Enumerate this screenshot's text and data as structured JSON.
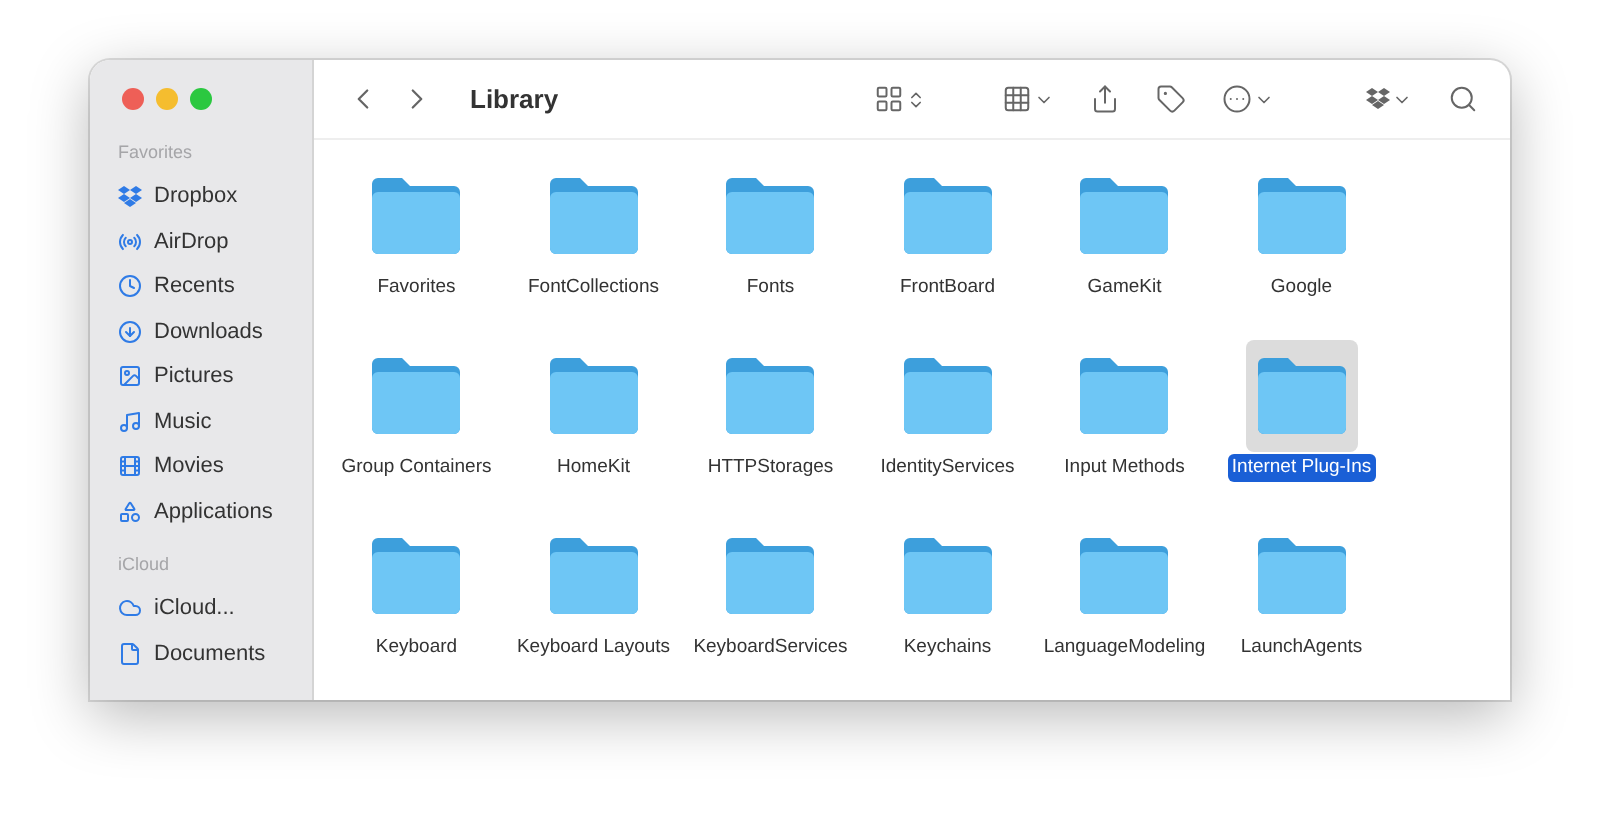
{
  "toolbar": {
    "title": "Library"
  },
  "sidebar": {
    "sections": [
      {
        "title": "Favorites",
        "items": [
          {
            "label": "Dropbox",
            "kind": "dropbox"
          },
          {
            "label": "AirDrop",
            "kind": "airdrop"
          },
          {
            "label": "Recents",
            "kind": "recents"
          },
          {
            "label": "Downloads",
            "kind": "downloads"
          },
          {
            "label": "Pictures",
            "kind": "pictures"
          },
          {
            "label": "Music",
            "kind": "music"
          },
          {
            "label": "Movies",
            "kind": "movies"
          },
          {
            "label": "Applications",
            "kind": "applications"
          }
        ]
      },
      {
        "title": "iCloud",
        "items": [
          {
            "label": "iCloud...",
            "kind": "cloud"
          },
          {
            "label": "Documents",
            "kind": "document"
          }
        ]
      }
    ]
  },
  "files": [
    {
      "label": "Favorites",
      "selected": false
    },
    {
      "label": "FontCollections",
      "selected": false
    },
    {
      "label": "Fonts",
      "selected": false
    },
    {
      "label": "FrontBoard",
      "selected": false
    },
    {
      "label": "GameKit",
      "selected": false
    },
    {
      "label": "Google",
      "selected": false
    },
    {
      "label": "Group Containers",
      "selected": false
    },
    {
      "label": "HomeKit",
      "selected": false
    },
    {
      "label": "HTTPStorages",
      "selected": false
    },
    {
      "label": "IdentityServices",
      "selected": false
    },
    {
      "label": "Input Methods",
      "selected": false
    },
    {
      "label": "Internet Plug-Ins",
      "selected": true
    },
    {
      "label": "Keyboard",
      "selected": false
    },
    {
      "label": "Keyboard Layouts",
      "selected": false
    },
    {
      "label": "KeyboardServices",
      "selected": false
    },
    {
      "label": "Keychains",
      "selected": false
    },
    {
      "label": "LanguageModeling",
      "selected": false
    },
    {
      "label": "LaunchAgents",
      "selected": false
    }
  ]
}
